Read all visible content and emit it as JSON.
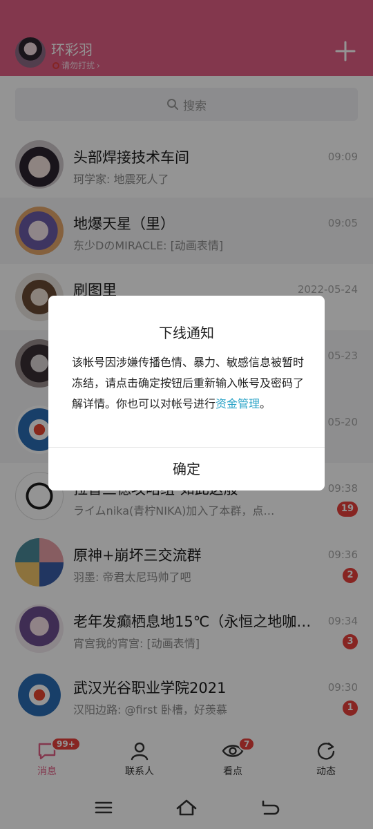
{
  "profile": {
    "name": "环彩羽",
    "status": "请勿打扰",
    "status_chevron": "›"
  },
  "search": {
    "placeholder": "搜索"
  },
  "chats": [
    {
      "title": "头部焊接技术车间",
      "preview": "珂学家: 地震死人了",
      "time": "09:09",
      "badge": ""
    },
    {
      "title": "地爆天星（里）",
      "preview": "东少DのMIRACLE: [动画表情]",
      "time": "09:05",
      "badge": ""
    },
    {
      "title": "刷图里",
      "preview": "",
      "time": "2022-05-24",
      "badge": ""
    },
    {
      "title": "",
      "preview": "",
      "time": "05-23",
      "badge": ""
    },
    {
      "title": "",
      "preview": "",
      "time": "05-20",
      "badge": ""
    },
    {
      "title": "拉普兰德攻略组-如此这般",
      "preview": "ライムnika(青柠NIKA)加入了本群，点…",
      "time": "09:38",
      "badge": "19"
    },
    {
      "title": "原神+崩坏三交流群",
      "preview": "羽墨: 帝君太尼玛帅了吧",
      "time": "09:36",
      "badge": "2"
    },
    {
      "title": "老年发癫栖息地15℃（永恒之地咖…",
      "preview": "宵宫我的宵宫: [动画表情]",
      "time": "09:34",
      "badge": "3"
    },
    {
      "title": "武汉光谷职业学院2021",
      "preview": "汉阳边路: @first 卧槽，好羡慕",
      "time": "09:30",
      "badge": "1"
    }
  ],
  "tabs": {
    "messages": {
      "label": "消息",
      "badge": "99+"
    },
    "contacts": {
      "label": "联系人"
    },
    "watch": {
      "label": "看点",
      "badge": "7"
    },
    "feed": {
      "label": "动态"
    }
  },
  "dialog": {
    "title": "下线通知",
    "message": "该帐号因涉嫌传播色情、暴力、敏感信息被暂时冻结，请点击确定按钮后重新输入帐号及密码了解详情。你也可以对帐号进行",
    "link": "资金管理",
    "message_end": "。",
    "confirm": "确定"
  },
  "colors": {
    "header": "#e25f86",
    "badge": "#e8413b",
    "link": "#2aa3c7"
  }
}
